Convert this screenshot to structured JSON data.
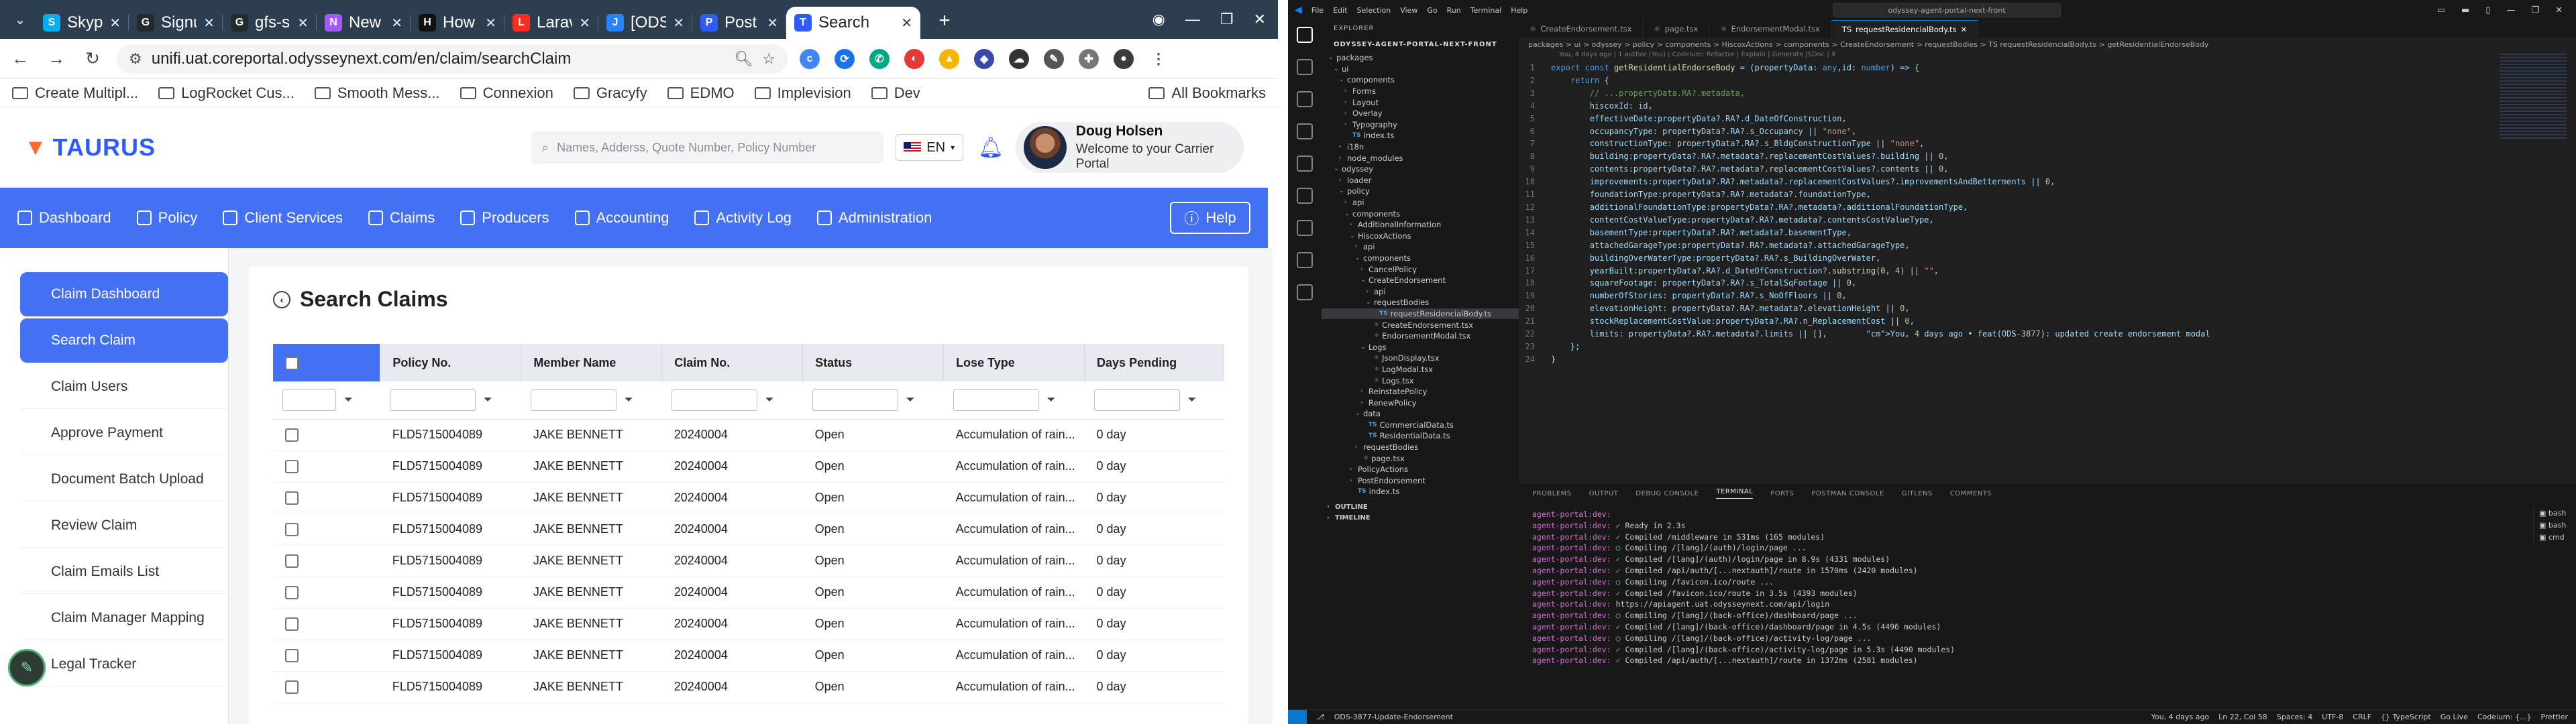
{
  "browser": {
    "tabs": [
      {
        "title": "Skype",
        "color": "#00aff0",
        "icon": "S"
      },
      {
        "title": "Signup",
        "color": "#24292e",
        "icon": "G"
      },
      {
        "title": "gfs-saa",
        "color": "#24292e",
        "icon": "G"
      },
      {
        "title": "New Ta",
        "color": "#a259ff",
        "icon": "N"
      },
      {
        "title": "How to",
        "color": "#111111",
        "icon": "H"
      },
      {
        "title": "Larave",
        "color": "#ff2d20",
        "icon": "L"
      },
      {
        "title": "[ODS-3",
        "color": "#2684ff",
        "icon": "J"
      },
      {
        "title": "Post Ar",
        "color": "#2e5bff",
        "icon": "P"
      }
    ],
    "active_tab": {
      "title": "Search",
      "icon": "T",
      "color": "#2e5bff"
    },
    "url": "unifi.uat.coreportal.odysseynext.com/en/claim/searchClaim",
    "bookmarks": [
      "Create Multipl...",
      "LogRocket Cus...",
      "Smooth Mess...",
      "Connexion",
      "Gracyfy",
      "EDMO",
      "Implevision",
      "Dev"
    ],
    "all_bookmarks": "All Bookmarks"
  },
  "app": {
    "brand": "TAURUS",
    "search_placeholder": "Names, Adderss, Quote Number, Policy Number",
    "lang": "EN",
    "user_name": "Doug Holsen",
    "user_welcome": "Welcome to your Carrier Portal",
    "nav": [
      "Dashboard",
      "Policy",
      "Client Services",
      "Claims",
      "Producers",
      "Accounting",
      "Activity Log",
      "Administration"
    ],
    "help": "Help",
    "sidebar": [
      "Claim Dashboard",
      "Search Claim",
      "Claim Users",
      "Approve Payment",
      "Document Batch Upload",
      "Review Claim",
      "Claim Emails List",
      "Claim Manager Mapping",
      "Legal Tracker"
    ],
    "page_title": "Search Claims",
    "columns": [
      "Policy No.",
      "Member Name",
      "Claim No.",
      "Status",
      "Lose Type",
      "Days Pending"
    ],
    "rows": [
      [
        "FLD5715004089",
        "JAKE BENNETT",
        "20240004",
        "Open",
        "Accumulation of rain...",
        "0 day"
      ],
      [
        "FLD5715004089",
        "JAKE BENNETT",
        "20240004",
        "Open",
        "Accumulation of rain...",
        "0 day"
      ],
      [
        "FLD5715004089",
        "JAKE BENNETT",
        "20240004",
        "Open",
        "Accumulation of rain...",
        "0 day"
      ],
      [
        "FLD5715004089",
        "JAKE BENNETT",
        "20240004",
        "Open",
        "Accumulation of rain...",
        "0 day"
      ],
      [
        "FLD5715004089",
        "JAKE BENNETT",
        "20240004",
        "Open",
        "Accumulation of rain...",
        "0 day"
      ],
      [
        "FLD5715004089",
        "JAKE BENNETT",
        "20240004",
        "Open",
        "Accumulation of rain...",
        "0 day"
      ],
      [
        "FLD5715004089",
        "JAKE BENNETT",
        "20240004",
        "Open",
        "Accumulation of rain...",
        "0 day"
      ],
      [
        "FLD5715004089",
        "JAKE BENNETT",
        "20240004",
        "Open",
        "Accumulation of rain...",
        "0 day"
      ],
      [
        "FLD5715004089",
        "JAKE BENNETT",
        "20240004",
        "Open",
        "Accumulation of rain...",
        "0 day"
      ]
    ]
  },
  "vscode": {
    "menu": [
      "File",
      "Edit",
      "Selection",
      "View",
      "Go",
      "Run",
      "Terminal",
      "Help"
    ],
    "command_center": "odyssey-agent-portal-next-front",
    "explorer_title": "EXPLORER",
    "workspace": "ODYSSEY-AGENT-PORTAL-NEXT-FRONT",
    "tree": [
      {
        "label": "packages",
        "indent": 0,
        "caret": "v",
        "badge": ""
      },
      {
        "label": "ui",
        "indent": 1,
        "caret": "v",
        "badge": ""
      },
      {
        "label": "components",
        "indent": 2,
        "caret": "v",
        "badge": ""
      },
      {
        "label": "Forms",
        "indent": 3,
        "caret": ">",
        "badge": ""
      },
      {
        "label": "Layout",
        "indent": 3,
        "caret": ">",
        "badge": ""
      },
      {
        "label": "Overlay",
        "indent": 3,
        "caret": ">",
        "badge": ""
      },
      {
        "label": "Typography",
        "indent": 3,
        "caret": ">",
        "badge": ""
      },
      {
        "label": "index.ts",
        "indent": 3,
        "caret": "",
        "badge": "TS"
      },
      {
        "label": "i18n",
        "indent": 2,
        "caret": ">",
        "badge": ""
      },
      {
        "label": "node_modules",
        "indent": 2,
        "caret": ">",
        "badge": ""
      },
      {
        "label": "odyssey",
        "indent": 1,
        "caret": "v",
        "badge": ""
      },
      {
        "label": "loader",
        "indent": 2,
        "caret": ">",
        "badge": ""
      },
      {
        "label": "policy",
        "indent": 2,
        "caret": "v",
        "badge": ""
      },
      {
        "label": "api",
        "indent": 3,
        "caret": ">",
        "badge": ""
      },
      {
        "label": "components",
        "indent": 3,
        "caret": "v",
        "badge": ""
      },
      {
        "label": "AdditionalInformation",
        "indent": 4,
        "caret": ">",
        "badge": ""
      },
      {
        "label": "HiscoxActions",
        "indent": 4,
        "caret": "v",
        "badge": ""
      },
      {
        "label": "api",
        "indent": 5,
        "caret": ">",
        "badge": ""
      },
      {
        "label": "components",
        "indent": 5,
        "caret": "v",
        "badge": ""
      },
      {
        "label": "CancelPolicy",
        "indent": 6,
        "caret": ">",
        "badge": ""
      },
      {
        "label": "CreateEndorsement",
        "indent": 6,
        "caret": "v",
        "badge": ""
      },
      {
        "label": "api",
        "indent": 7,
        "caret": ">",
        "badge": ""
      },
      {
        "label": "requestBodies",
        "indent": 7,
        "caret": "v",
        "badge": ""
      },
      {
        "label": "requestResidencialBody.ts",
        "indent": 8,
        "caret": "",
        "badge": "TS"
      },
      {
        "label": "CreateEndorsement.tsx",
        "indent": 7,
        "caret": "",
        "badge": "⚛"
      },
      {
        "label": "EndorsementModal.tsx",
        "indent": 7,
        "caret": "",
        "badge": "⚛"
      },
      {
        "label": "Logs",
        "indent": 6,
        "caret": "v",
        "badge": ""
      },
      {
        "label": "JsonDisplay.tsx",
        "indent": 7,
        "caret": "",
        "badge": "⚛"
      },
      {
        "label": "LogModal.tsx",
        "indent": 7,
        "caret": "",
        "badge": "⚛"
      },
      {
        "label": "Logs.tsx",
        "indent": 7,
        "caret": "",
        "badge": "⚛"
      },
      {
        "label": "ReinstatePolicy",
        "indent": 6,
        "caret": ">",
        "badge": ""
      },
      {
        "label": "RenewPolicy",
        "indent": 6,
        "caret": ">",
        "badge": ""
      },
      {
        "label": "data",
        "indent": 5,
        "caret": "v",
        "badge": ""
      },
      {
        "label": "CommercialData.ts",
        "indent": 6,
        "caret": "",
        "badge": "TS"
      },
      {
        "label": "ResidentialData.ts",
        "indent": 6,
        "caret": "",
        "badge": "TS"
      },
      {
        "label": "requestBodies",
        "indent": 5,
        "caret": ">",
        "badge": ""
      },
      {
        "label": "page.tsx",
        "indent": 5,
        "caret": "",
        "badge": "⚛"
      },
      {
        "label": "PolicyActions",
        "indent": 4,
        "caret": ">",
        "badge": ""
      },
      {
        "label": "PostEndorsement",
        "indent": 4,
        "caret": ">",
        "badge": ""
      },
      {
        "label": "index.ts",
        "indent": 4,
        "caret": "",
        "badge": "TS"
      }
    ],
    "outline": "OUTLINE",
    "timeline": "TIMELINE",
    "editor_tabs": [
      "CreateEndorsement.tsx",
      "page.tsx",
      "EndorsementModal.tsx",
      "requestResidencialBody.ts"
    ],
    "breadcrumb": "packages > ui > odyssey > policy > components > HiscoxActions > components > CreateEndorsement > requestBodies > TS requestResidencialBody.ts > getResidentialEndorseBody",
    "blame": "You, 4 days ago | 1 author (You) | Codeium: Refactor | Explain | Generate JSDoc | X",
    "code_lines": [
      "export const getResidentialEndorseBody = (propertyData: any,id: number) => {",
      "    return {",
      "        // ...propertyData.RA?.metadata,",
      "        hiscoxId: id,",
      "        effectiveDate:propertyData?.RA?.d_DateOfConstruction,",
      "        occupancyType: propertyData?.RA?.s_Occupancy || \"none\",",
      "        constructionType: propertyData?.RA?.s_BldgConstructionType || \"none\",",
      "        building:propertyData?.RA?.metadata?.replacementCostValues?.building || 0,",
      "        contents:propertyData?.RA?.metadata?.replacementCostValues?.contents || 0,",
      "        improvements:propertyData?.RA?.metadata?.replacementCostValues?.improvementsAndBetterments || 0,",
      "        foundationType:propertyData?.RA?.metadata?.foundationType,",
      "        additionalFoundationType:propertyData?.RA?.metadata?.additionalFoundationType,",
      "        contentCostValueType:propertyData?.RA?.metadata?.contentsCostValueType,",
      "        basementType:propertyData?.RA?.metadata?.basementType,",
      "        attachedGarageType:propertyData?.RA?.metadata?.attachedGarageType,",
      "        buildingOverWaterType:propertyData?.RA?.s_BuildingOverWater,",
      "        yearBuilt:propertyData?.RA?.d_DateOfConstruction?.substring(0, 4) || \"\",",
      "        squareFootage: propertyData?.RA?.s_TotalSqFootage || 0,",
      "        numberOfStories: propertyData?.RA?.s_NoOfFloors || 0,",
      "        elevationHeight: propertyData?.RA?.metadata?.elevationHeight || 0,",
      "        stockReplacementCostValue:propertyData?.RA?.n_ReplacementCost || 0,",
      "        limits: propertyData?.RA?.metadata?.limits || [],        You, 4 days ago • feat(ODS-3877): updated create endorsement modal",
      "    };",
      "}"
    ],
    "panel_tabs": [
      "PROBLEMS",
      "OUTPUT",
      "DEBUG CONSOLE",
      "TERMINAL",
      "PORTS",
      "POSTMAN CONSOLE",
      "GITLENS",
      "COMMENTS"
    ],
    "terminal": [
      {
        "p": "agent-portal:dev:",
        "ok": "",
        "t": ""
      },
      {
        "p": "agent-portal:dev:",
        "ok": "✓",
        "t": " Ready in 2.3s"
      },
      {
        "p": "agent-portal:dev:",
        "ok": "✓",
        "t": " Compiled /middleware in 531ms (165 modules)"
      },
      {
        "p": "agent-portal:dev:",
        "ok": "○",
        "t": " Compiling /[lang]/(auth)/login/page ..."
      },
      {
        "p": "agent-portal:dev:",
        "ok": "✓",
        "t": " Compiled /[lang]/(auth)/login/page in 8.9s (4331 modules)"
      },
      {
        "p": "agent-portal:dev:",
        "ok": "✓",
        "t": " Compiled /api/auth/[...nextauth]/route in 1570ms (2420 modules)"
      },
      {
        "p": "agent-portal:dev:",
        "ok": "○",
        "t": " Compiling /favicon.ico/route ..."
      },
      {
        "p": "agent-portal:dev:",
        "ok": "✓",
        "t": " Compiled /favicon.ico/route in 3.5s (4393 modules)"
      },
      {
        "p": "agent-portal:dev:",
        "ok": "",
        "t": " https://apiagent.uat.odysseynext.com/api/login"
      },
      {
        "p": "agent-portal:dev:",
        "ok": "○",
        "t": " Compiling /[lang]/(back-office)/dashboard/page ..."
      },
      {
        "p": "agent-portal:dev:",
        "ok": "✓",
        "t": " Compiled /[lang]/(back-office)/dashboard/page in 4.5s (4496 modules)"
      },
      {
        "p": "agent-portal:dev:",
        "ok": "○",
        "t": " Compiling /[lang]/(back-office)/activity-log/page ..."
      },
      {
        "p": "agent-portal:dev:",
        "ok": "✓",
        "t": " Compiled /[lang]/(back-office)/activity-log/page in 5.3s (4490 modules)"
      },
      {
        "p": "agent-portal:dev:",
        "ok": "✓",
        "t": " Compiled /api/auth/[...nextauth]/route in 1372ms (2581 modules)"
      }
    ],
    "terminal_list": [
      "bash",
      "bash",
      "cmd"
    ],
    "status_left": "ODS-3877-Update-Endorsement",
    "status_right": [
      "You, 4 days ago",
      "Ln 22, Col 58",
      "Spaces: 4",
      "UTF-8",
      "CRLF",
      "{} TypeScript",
      "Go Live",
      "Codeium: {...}",
      "Prettier"
    ]
  }
}
